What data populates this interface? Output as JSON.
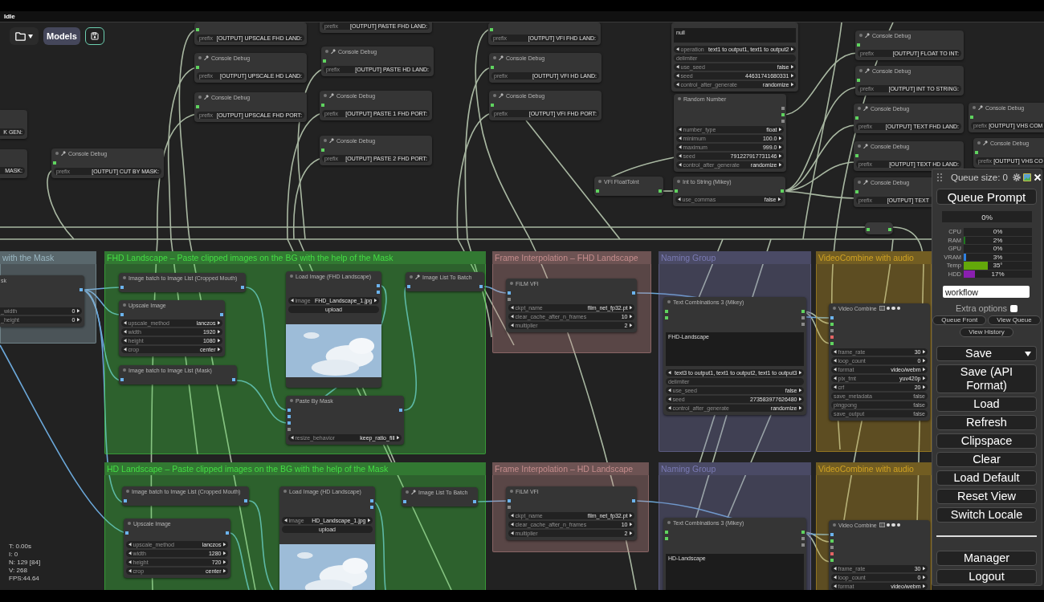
{
  "status_bar": {
    "text": "Idle"
  },
  "toolbar": {
    "models_button": "Models"
  },
  "canvas": {
    "groups": [
      {
        "title": "with the Mask",
        "color": "#9ab7c2",
        "nodes": [
          {
            "kind": "plain",
            "title": "sk",
            "outputs": [
              {
                "color": "#6cb4ee"
              }
            ],
            "widgets": [
              {
                "kind": "number",
                "label": "_width",
                "value": "0"
              },
              {
                "kind": "number",
                "label": "_height",
                "value": "0"
              }
            ]
          }
        ]
      },
      {
        "title": "FHD Landscape – Paste clipped images on the BG with the help of the Mask",
        "color": "#44dd44",
        "nodes": [
          {
            "kind": "plain",
            "title": "Image batch to Image List (Cropped Mouth)",
            "inputs": [
              {
                "color": "#6cb4ee"
              }
            ],
            "outputs": [
              {
                "color": "#6cb4ee"
              }
            ]
          },
          {
            "kind": "plain",
            "title": "Upscale Image",
            "inputs": [
              {
                "color": "#6cb4ee"
              }
            ],
            "outputs": [
              {
                "color": "#6cb4ee"
              }
            ],
            "widgets": [
              {
                "kind": "combo",
                "label": "upscale_method",
                "value": "lanczos"
              },
              {
                "kind": "number",
                "label": "width",
                "value": "1920"
              },
              {
                "kind": "number",
                "label": "height",
                "value": "1080"
              },
              {
                "kind": "combo",
                "label": "crop",
                "value": "center"
              }
            ]
          },
          {
            "kind": "plain",
            "title": "Image batch to Image List (Mask)",
            "inputs": [
              {
                "color": "#6cb4ee"
              }
            ],
            "outputs": [
              {
                "color": "#6cb4ee"
              }
            ]
          },
          {
            "kind": "plain",
            "title": "Load Image (FHD Landscape)",
            "outputs": [
              {
                "color": "#6cb4ee"
              },
              {
                "color": "#6cb4ee"
              }
            ],
            "widgets": [
              {
                "kind": "combo",
                "label": "image",
                "value": "FHD_Landscape_1.jpg"
              },
              {
                "kind": "button",
                "label": "upload"
              },
              {
                "kind": "image"
              }
            ]
          },
          {
            "kind": "plain",
            "title": "Paste By Mask",
            "inputs": [
              {
                "color": "#6cb4ee"
              },
              {
                "color": "#6cb4ee"
              },
              {
                "color": "#6cb4ee"
              },
              {
                "color": "#8a8a8a"
              }
            ],
            "outputs": [
              {
                "color": "#6cb4ee"
              }
            ],
            "widgets": [
              {
                "kind": "combo",
                "label": "resize_behavior",
                "value": "keep_ratio_fill"
              }
            ]
          },
          {
            "kind": "tool",
            "title": "Image List To Batch",
            "inputs": [
              {
                "color": "#6cb4ee"
              }
            ],
            "outputs": [
              {
                "color": "#6cb4ee"
              }
            ]
          }
        ]
      },
      {
        "title": "HD Landscape – Paste clipped images on the BG with the help of the Mask",
        "color": "#44dd44",
        "nodes": [
          {
            "kind": "plain",
            "title": "Image batch to Image List (Cropped Mouth)",
            "inputs": [
              {
                "color": "#6cb4ee"
              }
            ],
            "outputs": [
              {
                "color": "#6cb4ee"
              }
            ]
          },
          {
            "kind": "plain",
            "title": "Upscale Image",
            "inputs": [
              {
                "color": "#6cb4ee"
              }
            ],
            "outputs": [
              {
                "color": "#6cb4ee"
              }
            ],
            "widgets": [
              {
                "kind": "combo",
                "label": "upscale_method",
                "value": "lanczos"
              },
              {
                "kind": "number",
                "label": "width",
                "value": "1280"
              },
              {
                "kind": "number",
                "label": "height",
                "value": "720"
              },
              {
                "kind": "combo",
                "label": "crop",
                "value": "center"
              }
            ]
          },
          {
            "kind": "plain",
            "title": "Load Image (HD Landscape)",
            "outputs": [
              {
                "color": "#6cb4ee"
              },
              {
                "color": "#6cb4ee"
              }
            ],
            "widgets": [
              {
                "kind": "combo",
                "label": "image",
                "value": "HD_Landscape_1.jpg"
              },
              {
                "kind": "button",
                "label": "upload"
              },
              {
                "kind": "image"
              }
            ]
          },
          {
            "kind": "tool",
            "title": "Image List To Batch",
            "inputs": [
              {
                "color": "#6cb4ee"
              }
            ],
            "outputs": [
              {
                "color": "#6cb4ee"
              }
            ]
          }
        ]
      },
      {
        "title": "Frame Interpolation – FHD Landscape",
        "color": "#c48c8c",
        "nodes": [
          {
            "kind": "plain",
            "title": "FILM VFI",
            "inputs": [
              {
                "color": "#6cb4ee"
              },
              {
                "color": "#8a8a8a"
              }
            ],
            "outputs": [
              {
                "color": "#6cb4ee"
              }
            ],
            "widgets": [
              {
                "kind": "combo",
                "label": "ckpt_name",
                "value": "film_net_fp32.pt"
              },
              {
                "kind": "number",
                "label": "clear_cache_after_n_frames",
                "value": "10"
              },
              {
                "kind": "number",
                "label": "multiplier",
                "value": "2"
              }
            ]
          }
        ]
      },
      {
        "title": "Frame Interpolation – HD Landscape",
        "color": "#c48c8c",
        "nodes": [
          {
            "kind": "plain",
            "title": "FILM VFI",
            "inputs": [
              {
                "color": "#6cb4ee"
              },
              {
                "color": "#8a8a8a"
              }
            ],
            "outputs": [
              {
                "color": "#6cb4ee"
              }
            ],
            "widgets": [
              {
                "kind": "combo",
                "label": "ckpt_name",
                "value": "film_net_fp32.pt"
              },
              {
                "kind": "number",
                "label": "clear_cache_after_n_frames",
                "value": "10"
              },
              {
                "kind": "number",
                "label": "multiplier",
                "value": "2"
              }
            ]
          }
        ]
      },
      {
        "title": "Naming Group",
        "color": "#7a7ab4",
        "nodes": [
          {
            "kind": "plain",
            "title": "Text Combinations 3 (Mikey)",
            "inputs": [
              {
                "color": "#5fd35f"
              },
              {
                "color": "#5fd35f"
              }
            ],
            "outputs": [
              {
                "color": "#5fd35f"
              },
              {
                "color": "#8a8a8a"
              },
              {
                "color": "#8a8a8a"
              }
            ],
            "widgets": [
              {
                "kind": "textarea",
                "value": "FHD-Landscape"
              },
              {
                "kind": "combo",
                "value": "text3 to output1, text1 to output2, text1 to output3"
              },
              {
                "kind": "string",
                "label": "delimiter"
              },
              {
                "kind": "combo",
                "label": "use_seed",
                "value": "false"
              },
              {
                "kind": "number",
                "label": "seed",
                "value": "273583977626480"
              },
              {
                "kind": "combo",
                "label": "control_after_generate",
                "value": "randomize"
              }
            ]
          }
        ]
      },
      {
        "title": "Naming Group",
        "color": "#7a7ab4",
        "nodes": [
          {
            "kind": "plain",
            "title": "Text Combinations 3 (Mikey)",
            "inputs": [
              {
                "color": "#5fd35f"
              },
              {
                "color": "#5fd35f"
              }
            ],
            "outputs": [
              {
                "color": "#5fd35f"
              },
              {
                "color": "#8a8a8a"
              },
              {
                "color": "#8a8a8a"
              }
            ],
            "widgets": [
              {
                "kind": "textarea",
                "value": "HD-Landscape"
              }
            ]
          }
        ]
      },
      {
        "title": "VideoCombine with audio",
        "color": "#d0a222",
        "nodes": [
          {
            "kind": "video",
            "title": "Video Combine",
            "inputs": [
              {
                "color": "#6cb4ee"
              },
              {
                "color": "#5fd35f"
              },
              {
                "color": "#8a8a8a"
              },
              {
                "color": "#e46464"
              },
              {
                "color": "#5fd35f"
              }
            ],
            "widgets": [
              {
                "kind": "number",
                "label": "frame_rate",
                "value": "30"
              },
              {
                "kind": "number",
                "label": "loop_count",
                "value": "0"
              },
              {
                "kind": "combo",
                "label": "format",
                "value": "video/webm"
              },
              {
                "kind": "combo",
                "label": "pix_fmt",
                "value": "yuv420p"
              },
              {
                "kind": "number",
                "label": "crf",
                "value": "20"
              },
              {
                "kind": "toggle",
                "label": "save_metadata",
                "value": "false"
              },
              {
                "kind": "toggle",
                "label": "pingpong",
                "value": "false"
              },
              {
                "kind": "toggle",
                "label": "save_output",
                "value": "false"
              }
            ]
          }
        ]
      },
      {
        "title": "VideoCombine with audio",
        "color": "#d0a222",
        "nodes": [
          {
            "kind": "video",
            "title": "Video Combine",
            "inputs": [
              {
                "color": "#6cb4ee"
              },
              {
                "color": "#5fd35f"
              },
              {
                "color": "#8a8a8a"
              },
              {
                "color": "#e46464"
              },
              {
                "color": "#5fd35f"
              }
            ],
            "widgets": [
              {
                "kind": "number",
                "label": "frame_rate",
                "value": "30"
              },
              {
                "kind": "number",
                "label": "loop_count",
                "value": "0"
              },
              {
                "kind": "combo",
                "label": "format",
                "value": "video/webm"
              }
            ]
          }
        ]
      }
    ],
    "free_nodes": [
      {
        "kind": "plain",
        "widgets": [
          {
            "kind": "string",
            "value": "K GEN:"
          }
        ]
      },
      {
        "kind": "plain",
        "widgets": [
          {
            "kind": "string",
            "value": "MASK:"
          }
        ]
      },
      {
        "kind": "tool",
        "title": "Console Debug",
        "inputs": [
          {
            "color": "#5fd35f"
          }
        ],
        "widgets": [
          {
            "kind": "string",
            "label": "prefix",
            "value": "[OUTPUT] CUT BY MASK:"
          }
        ]
      },
      {
        "kind": "plain",
        "inputs": [
          {
            "color": "#5fd35f"
          }
        ],
        "widgets": [
          {
            "kind": "string",
            "label": "prefix",
            "value": "[OUTPUT] UPSCALE FHD LAND:"
          }
        ]
      },
      {
        "kind": "tool",
        "title": "Console Debug",
        "inputs": [
          {
            "color": "#5fd35f"
          }
        ],
        "widgets": [
          {
            "kind": "string",
            "label": "prefix",
            "value": "[OUTPUT] UPSCALE HD LAND:"
          }
        ]
      },
      {
        "kind": "tool",
        "title": "Console Debug",
        "inputs": [
          {
            "color": "#5fd35f"
          }
        ],
        "widgets": [
          {
            "kind": "string",
            "label": "prefix",
            "value": "[OUTPUT] UPSCALE FHD PORT:"
          }
        ]
      },
      {
        "kind": "plain",
        "widgets": [
          {
            "kind": "string",
            "label": "prefix",
            "value": "[OUTPUT] PASTE FHD LAND:"
          }
        ]
      },
      {
        "kind": "tool",
        "title": "Console Debug",
        "inputs": [
          {
            "color": "#5fd35f"
          }
        ],
        "widgets": [
          {
            "kind": "string",
            "label": "prefix",
            "value": "[OUTPUT] PASTE HD LAND:"
          }
        ]
      },
      {
        "kind": "tool",
        "title": "Console Debug",
        "inputs": [
          {
            "color": "#5fd35f"
          }
        ],
        "widgets": [
          {
            "kind": "string",
            "label": "prefix",
            "value": "[OUTPUT] PASTE 1 FHD PORT:"
          }
        ]
      },
      {
        "kind": "tool",
        "title": "Console Debug",
        "inputs": [
          {
            "color": "#5fd35f"
          }
        ],
        "widgets": [
          {
            "kind": "string",
            "label": "prefix",
            "value": "[OUTPUT] PASTE 2 FHD PORT:"
          }
        ]
      },
      {
        "kind": "plain",
        "inputs": [
          {
            "color": "#5fd35f"
          }
        ],
        "widgets": [
          {
            "kind": "string",
            "label": "prefix",
            "value": "[OUTPUT] VFI FHD LAND:"
          }
        ]
      },
      {
        "kind": "tool",
        "title": "Console Debug",
        "inputs": [
          {
            "color": "#5fd35f"
          }
        ],
        "widgets": [
          {
            "kind": "string",
            "label": "prefix",
            "value": "[OUTPUT] VFI HD LAND:"
          }
        ]
      },
      {
        "kind": "tool",
        "title": "Console Debug",
        "inputs": [
          {
            "color": "#5fd35f"
          }
        ],
        "widgets": [
          {
            "kind": "string",
            "label": "prefix",
            "value": "[OUTPUT] VFI FHD PORT:"
          }
        ]
      },
      {
        "kind": "plain",
        "widgets": [
          {
            "kind": "textarea",
            "value": "null"
          },
          {
            "kind": "combo",
            "label": "operation",
            "value": "text1 to output1, text1 to output2"
          },
          {
            "kind": "string",
            "label": "delimiter"
          },
          {
            "kind": "combo",
            "label": "use_seed",
            "value": "false"
          },
          {
            "kind": "number",
            "label": "seed",
            "value": "44631741680331"
          },
          {
            "kind": "combo",
            "label": "control_after_generate",
            "value": "randomize"
          }
        ]
      },
      {
        "kind": "plain",
        "title": "Random Number",
        "outputs": [
          {
            "color": "#8a8a8a"
          },
          {
            "color": "#5fd35f"
          },
          {
            "color": "#8a8a8a"
          }
        ],
        "widgets": [
          {
            "kind": "combo",
            "label": "number_type",
            "value": "float"
          },
          {
            "kind": "number",
            "label": "minimum",
            "value": "100.0"
          },
          {
            "kind": "number",
            "label": "maximum",
            "value": "999.0"
          },
          {
            "kind": "number",
            "label": "seed",
            "value": "791227917731146"
          },
          {
            "kind": "combo",
            "label": "control_after_generate",
            "value": "randomize"
          }
        ]
      },
      {
        "kind": "plain",
        "title": "VFI FloatToInt",
        "inputs": [
          {
            "color": "#5fd35f"
          }
        ],
        "outputs": [
          {
            "color": "#5fd35f"
          }
        ]
      },
      {
        "kind": "plain",
        "title": "Int to String (Mikey)",
        "inputs": [
          {
            "color": "#5fd35f"
          }
        ],
        "outputs": [
          {
            "color": "#5fd35f"
          }
        ],
        "widgets": [
          {
            "kind": "combo",
            "label": "use_commas",
            "value": "false"
          }
        ]
      },
      {
        "kind": "tool",
        "title": "Console Debug",
        "inputs": [
          {
            "color": "#5fd35f"
          }
        ],
        "widgets": [
          {
            "kind": "string",
            "label": "prefix",
            "value": "[OUTPUT] FLOAT TO INT:"
          }
        ]
      },
      {
        "kind": "tool",
        "title": "Console Debug",
        "inputs": [
          {
            "color": "#5fd35f"
          }
        ],
        "widgets": [
          {
            "kind": "string",
            "label": "prefix",
            "value": "[OUTPUT] INT TO STRING:"
          }
        ]
      },
      {
        "kind": "tool",
        "title": "Console Debug",
        "inputs": [
          {
            "color": "#5fd35f"
          }
        ],
        "widgets": [
          {
            "kind": "string",
            "label": "prefix",
            "value": "[OUTPUT] TEXT FHD LAND:"
          }
        ]
      },
      {
        "kind": "tool",
        "title": "Console Debug",
        "inputs": [
          {
            "color": "#5fd35f"
          }
        ],
        "widgets": [
          {
            "kind": "string",
            "label": "prefix",
            "value": "[OUTPUT] TEXT HD LAND:"
          }
        ]
      },
      {
        "kind": "tool",
        "title": "Console Debug",
        "inputs": [
          {
            "color": "#5fd35f"
          }
        ],
        "widgets": [
          {
            "kind": "string",
            "label": "prefix",
            "value": "[OUTPUT] TEXT"
          }
        ]
      },
      {
        "kind": "tool",
        "title": "Console Debug",
        "inputs": [
          {
            "color": "#5fd35f"
          }
        ],
        "widgets": [
          {
            "kind": "string",
            "label": "prefix",
            "value": "[OUTPUT] VHS COM"
          }
        ]
      },
      {
        "kind": "tool",
        "title": "Console Debug",
        "inputs": [
          {
            "color": "#5fd35f"
          }
        ],
        "widgets": [
          {
            "kind": "string",
            "label": "prefix",
            "value": "[OUTPUT] VHS CO"
          }
        ]
      },
      {
        "kind": "reroute",
        "inputs": [
          {
            "color": "#5fd35f"
          }
        ],
        "outputs": [
          {
            "color": "#5fd35f"
          }
        ]
      }
    ]
  },
  "render_stats": [
    "T: 0.00s",
    "I: 0",
    "N: 129 [84]",
    "V: 268",
    "FPS:44.64"
  ],
  "queue_panel": {
    "queue_size": "Queue size: 0",
    "queue_button": "Queue Prompt",
    "progress": {
      "level": 0,
      "reading": "0%"
    },
    "monitors": [
      {
        "label": "CPU",
        "level": 0,
        "reading": "0%"
      },
      {
        "label": "RAM",
        "level": 0.02,
        "reading": "2%",
        "color": "#1e7a1e"
      },
      {
        "label": "GPU",
        "level": 0,
        "reading": "0%"
      },
      {
        "label": "VRAM",
        "level": 0.03,
        "reading": "3%",
        "color": "#2f80e0"
      },
      {
        "label": "Temp",
        "level": 0.35,
        "reading": "35°",
        "color": "#63a80a"
      },
      {
        "label": "HDD",
        "level": 0.17,
        "reading": "17%",
        "color": "#8a1fb0"
      }
    ],
    "workflow_field": {
      "value": "workflow"
    },
    "extra_options": {
      "label": "Extra options",
      "checked": false
    },
    "small_buttons": [
      "Queue Front",
      "View Queue",
      "View History"
    ],
    "save_button": "Save",
    "buttons": [
      "Save (API Format)",
      "Load",
      "Refresh",
      "Clipspace",
      "Clear",
      "Load Default",
      "Reset View",
      "Switch Locale"
    ],
    "footer_buttons": [
      "Manager",
      "Logout"
    ]
  }
}
